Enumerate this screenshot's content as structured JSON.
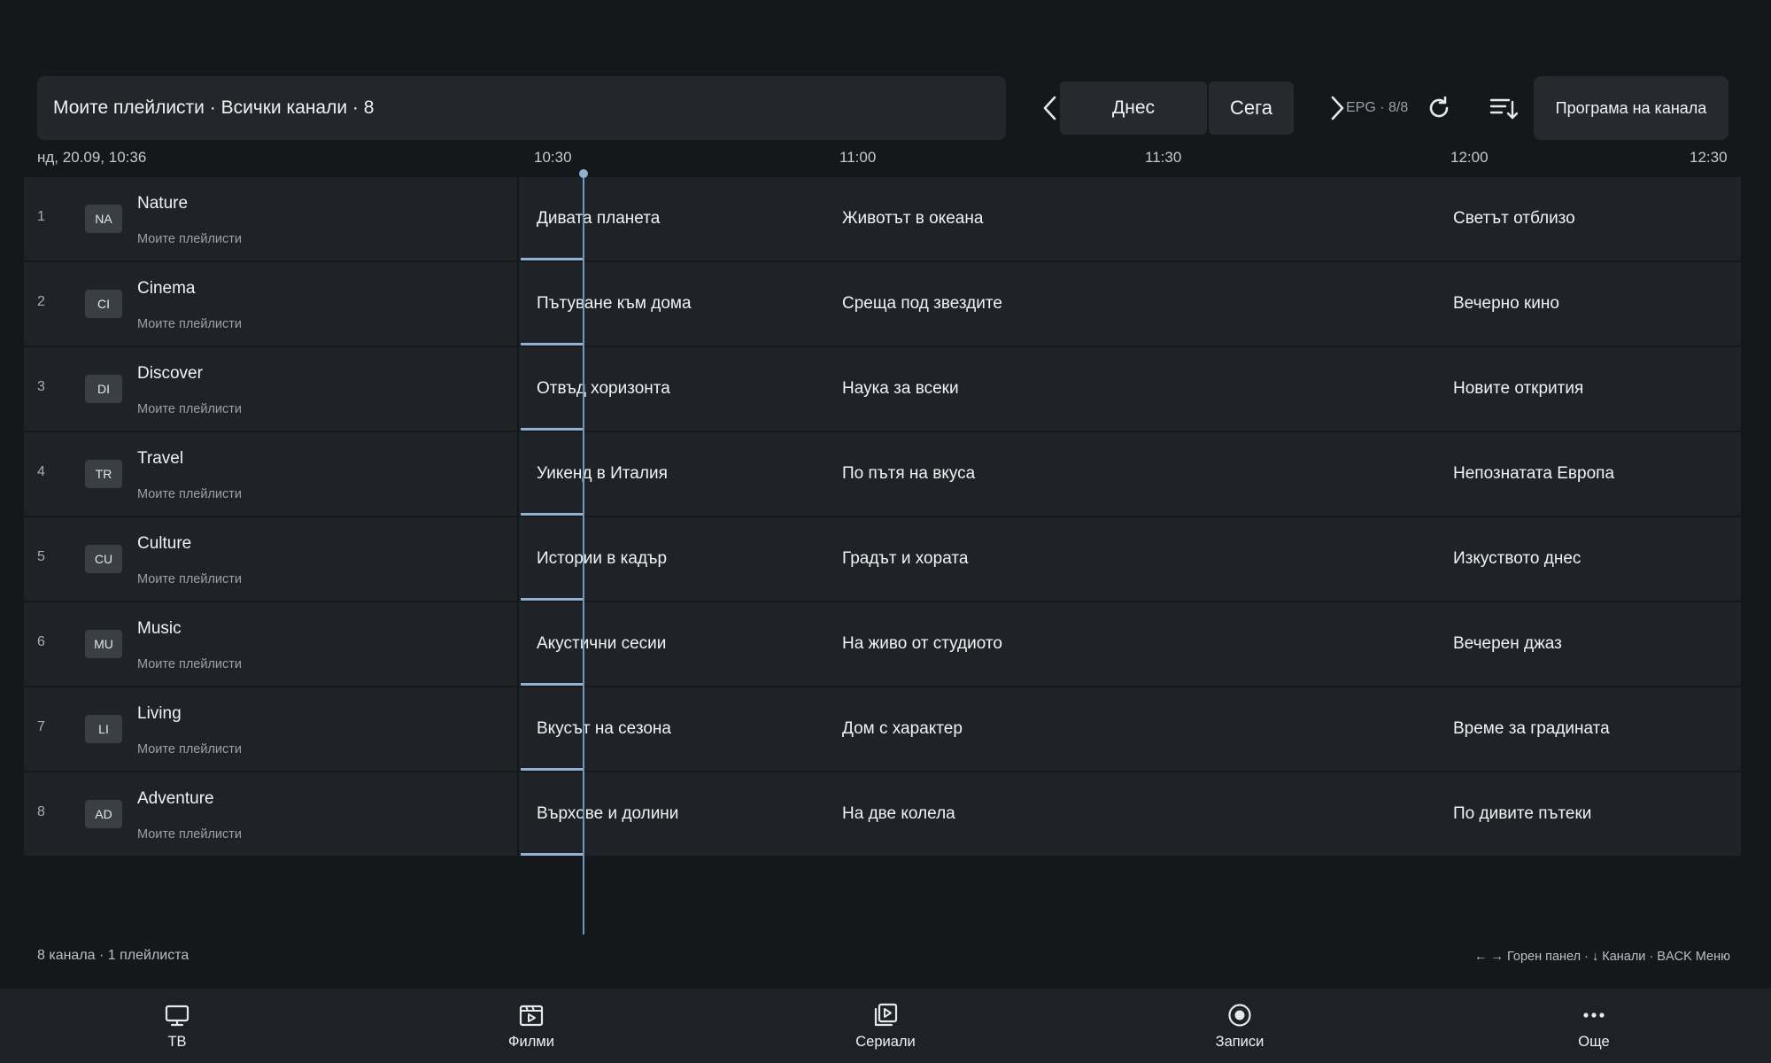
{
  "header": {
    "playlist_label": "Моите плейлисти · Всички канали · 8",
    "prev_day_icon": "chevron-left-icon",
    "today_label": "Днес",
    "now_label": "Сега",
    "next_day_icon": "chevron-right-icon",
    "epg_status": "EPG · 8/8",
    "refresh_icon": "refresh-icon",
    "sort_icon": "sort-icon",
    "channel_program_label": "Програма на канала"
  },
  "timeline": {
    "current_datetime": "нд, 20.09, 10:36",
    "ticks": [
      "10:30",
      "11:00",
      "11:30",
      "12:00",
      "12:30"
    ]
  },
  "channels": [
    {
      "num": "1",
      "logo": "NA",
      "name": "Nature",
      "playlist": "Моите плейлисти",
      "programs": [
        "Дивата планета",
        "Животът в океана",
        "Светът отблизо"
      ]
    },
    {
      "num": "2",
      "logo": "CI",
      "name": "Cinema",
      "playlist": "Моите плейлисти",
      "programs": [
        "Пътуване към дома",
        "Среща под звездите",
        "Вечерно кино"
      ]
    },
    {
      "num": "3",
      "logo": "DI",
      "name": "Discover",
      "playlist": "Моите плейлисти",
      "programs": [
        "Отвъд хоризонта",
        "Наука за всеки",
        "Новите открития"
      ]
    },
    {
      "num": "4",
      "logo": "TR",
      "name": "Travel",
      "playlist": "Моите плейлисти",
      "programs": [
        "Уикенд в Италия",
        "По пътя на вкуса",
        "Непознатата Европа"
      ]
    },
    {
      "num": "5",
      "logo": "CU",
      "name": "Culture",
      "playlist": "Моите плейлисти",
      "programs": [
        "Истории в кадър",
        "Градът и хората",
        "Изкуството днес"
      ]
    },
    {
      "num": "6",
      "logo": "MU",
      "name": "Music",
      "playlist": "Моите плейлисти",
      "programs": [
        "Акустични сесии",
        "На живо от студиото",
        "Вечерен джаз"
      ]
    },
    {
      "num": "7",
      "logo": "LI",
      "name": "Living",
      "playlist": "Моите плейлисти",
      "programs": [
        "Вкусът на сезона",
        "Дом с характер",
        "Време за градината"
      ]
    },
    {
      "num": "8",
      "logo": "AD",
      "name": "Adventure",
      "playlist": "Моите плейлисти",
      "programs": [
        "Върхове и долини",
        "На две колела",
        "По дивите пътеки"
      ]
    }
  ],
  "footer": {
    "summary": "8 канала · 1 плейлиста",
    "hint": "← → Горен панел · ↓ Канали · BACK Меню"
  },
  "bottom_nav": [
    {
      "label": "ТВ",
      "icon": "tv-icon"
    },
    {
      "label": "Филми",
      "icon": "movie-icon"
    },
    {
      "label": "Сериали",
      "icon": "series-icon"
    },
    {
      "label": "Записи",
      "icon": "record-icon"
    },
    {
      "label": "Още",
      "icon": "more-icon"
    }
  ],
  "colors": {
    "background": "#15181b",
    "row": "#1f2327",
    "accent": "#8fb2d4"
  }
}
